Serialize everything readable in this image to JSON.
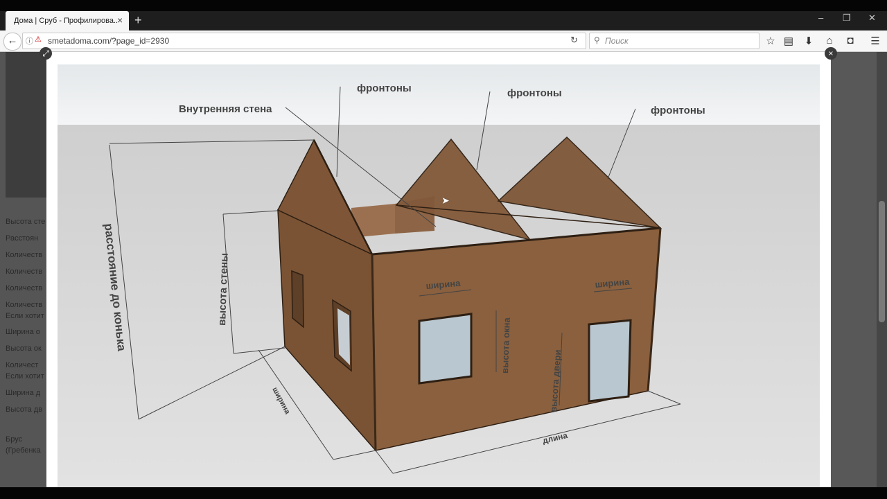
{
  "browser": {
    "tab_title": "Дома | Сруб - Профилирова...",
    "tab_close": "×",
    "new_tab": "+",
    "url": "smetadoma.com/?page_id=2930",
    "search_placeholder": "Поиск",
    "window_controls": {
      "minimize": "–",
      "restore": "❐",
      "close": "✕"
    }
  },
  "sidebar": {
    "labels": [
      "Высота сте",
      "Расстоян",
      "Количеств",
      "Количеств",
      "Количеств",
      "Количеств",
      "Если хотит",
      "Ширина о",
      "Высота ок",
      "Количест",
      "Если хотит",
      "Ширина д",
      "Высота дв",
      "Брус",
      "(Гребенка"
    ]
  },
  "diagram": {
    "labels": {
      "gable_1": "фронтоны",
      "gable_2": "фронтоны",
      "gable_3": "фронтоны",
      "inner_wall": "Внутренняя стена",
      "ridge_distance": "расстояние до конька",
      "wall_height": "высота стены",
      "window_width": "ширина",
      "window_height": "высота окна",
      "door_width": "ширина",
      "door_height": "высота двери",
      "side_width": "ширина",
      "length": "длина"
    },
    "colors": {
      "wall": "#8a603e",
      "wall_dark": "#6e4a2e",
      "gable": "#7e5637",
      "glass": "#b9c7d0",
      "floor": "#d8d8d8",
      "sky": "#eef0f1"
    }
  }
}
